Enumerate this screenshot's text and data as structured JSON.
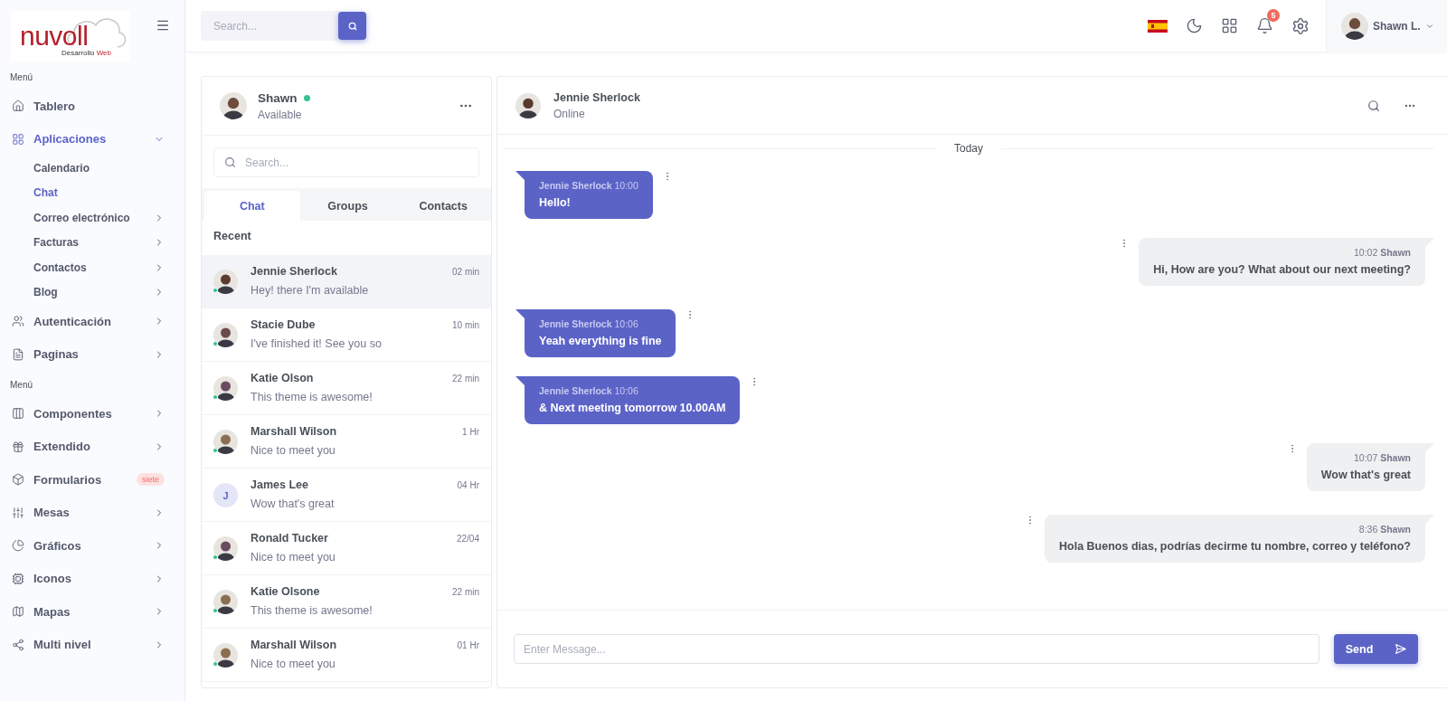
{
  "logo": {
    "name": "nuvoll",
    "tagline": "Desarrollo",
    "tagline_accent": "Web"
  },
  "sidebar": {
    "sections": [
      {
        "title": "Menú",
        "items": [
          {
            "label": "Tablero",
            "selected": false,
            "submenu": false
          },
          {
            "label": "Aplicaciones",
            "selected": true,
            "expanded": true,
            "submenu": true,
            "children": [
              {
                "label": "Calendario",
                "selected": false,
                "submenu": false
              },
              {
                "label": "Chat",
                "selected": true,
                "submenu": false
              },
              {
                "label": "Correo electrónico",
                "selected": false,
                "submenu": true
              },
              {
                "label": "Facturas",
                "selected": false,
                "submenu": true
              },
              {
                "label": "Contactos",
                "selected": false,
                "submenu": true
              },
              {
                "label": "Blog",
                "selected": false,
                "submenu": true
              }
            ]
          },
          {
            "label": "Autenticación",
            "selected": false,
            "expanded": false,
            "submenu": true
          },
          {
            "label": "Paginas",
            "selected": false,
            "expanded": false,
            "submenu": true
          }
        ]
      },
      {
        "title": "Menú",
        "items": [
          {
            "label": "Componentes",
            "selected": false,
            "expanded": false,
            "submenu": true
          },
          {
            "label": "Extendido",
            "selected": false,
            "expanded": false,
            "submenu": true
          },
          {
            "label": "Formularios",
            "selected": false,
            "submenu": false,
            "badge": "siete"
          },
          {
            "label": "Mesas",
            "selected": false,
            "expanded": false,
            "submenu": true
          },
          {
            "label": "Gráficos",
            "selected": false,
            "expanded": false,
            "submenu": true
          },
          {
            "label": "Iconos",
            "selected": false,
            "expanded": false,
            "submenu": true
          },
          {
            "label": "Mapas",
            "selected": false,
            "expanded": false,
            "submenu": true
          },
          {
            "label": "Multi nivel",
            "selected": false,
            "expanded": false,
            "submenu": true
          }
        ]
      }
    ]
  },
  "header": {
    "search": {
      "placeholder": "Search..."
    },
    "notifications": "5",
    "user": "Shawn L."
  },
  "chat_list": {
    "profile": {
      "name": "Shawn",
      "status": "Available",
      "online": true
    },
    "search": {
      "placeholder": "Search..."
    },
    "tabs": [
      {
        "label": "Chat",
        "selected": true
      },
      {
        "label": "Groups",
        "selected": false
      },
      {
        "label": "Contacts",
        "selected": false
      }
    ],
    "heading": "Recent",
    "conversations": [
      {
        "name": "Jennie Sherlock",
        "message": "Hey! there I'm available",
        "time": "02 min",
        "online": true,
        "selected": true
      },
      {
        "name": "Stacie Dube",
        "message": "I've finished it! See you so",
        "time": "10 min",
        "online": true,
        "selected": false
      },
      {
        "name": "Katie Olson",
        "message": "This theme is awesome!",
        "time": "22 min",
        "online": true,
        "selected": false
      },
      {
        "name": "Marshall Wilson",
        "message": "Nice to meet you",
        "time": "1 Hr",
        "online": true,
        "selected": false
      },
      {
        "name": "James Lee",
        "message": "Wow that's great",
        "time": "04 Hr",
        "online": false,
        "selected": false,
        "initial": "J"
      },
      {
        "name": "Ronald Tucker",
        "message": "Nice to meet you",
        "time": "22/04",
        "online": true,
        "selected": false
      },
      {
        "name": "Katie Olsone",
        "message": "This theme is awesome!",
        "time": "22 min",
        "online": true,
        "selected": false
      },
      {
        "name": "Marshall Wilson",
        "message": "Nice to meet you",
        "time": "01 Hr",
        "online": true,
        "selected": false
      }
    ]
  },
  "conversation": {
    "contact": {
      "name": "Jennie Sherlock",
      "status": "Online"
    },
    "divider": "Today",
    "messages": [
      {
        "kind": "incoming",
        "sender": "Jennie Sherlock",
        "time": "10:00",
        "text": "Hello!"
      },
      {
        "kind": "outgoing",
        "sender": "Shawn",
        "time": "10:02",
        "text": "Hi, How are you? What about our next meeting?"
      },
      {
        "kind": "incoming",
        "sender": "Jennie Sherlock",
        "time": "10:06",
        "text": "Yeah everything is fine"
      },
      {
        "kind": "incoming",
        "sender": "Jennie Sherlock",
        "time": "10:06",
        "text": "& Next meeting tomorrow 10.00AM"
      },
      {
        "kind": "outgoing",
        "sender": "Shawn",
        "time": "10:07",
        "text": "Wow that's great"
      },
      {
        "kind": "outgoing",
        "sender": "Shawn",
        "time": "8:36",
        "text": "Hola Buenos dias, podrías decirme tu nombre, correo y teléfono?"
      }
    ],
    "input": {
      "placeholder": "Enter Message..."
    },
    "send": "Send"
  }
}
